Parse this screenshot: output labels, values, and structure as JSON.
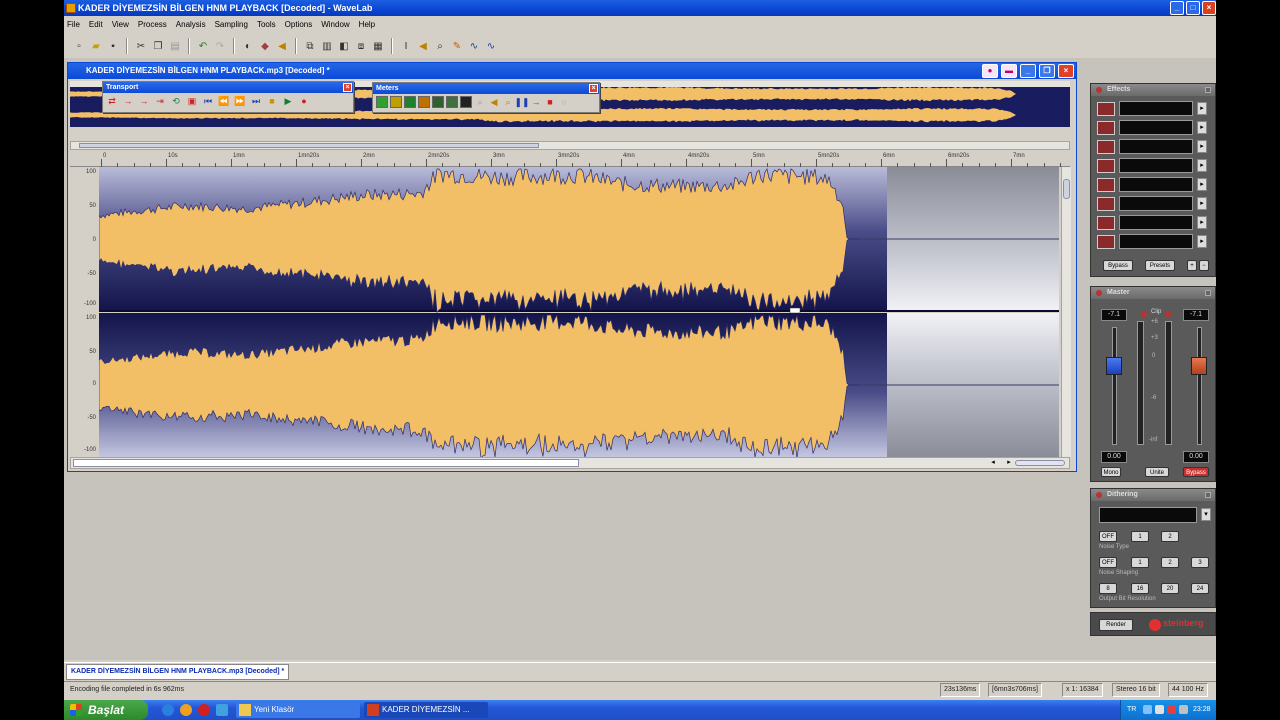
{
  "app": {
    "title": "KADER DİYEMEZSİN BİLGEN HNM PLAYBACK [Decoded] - WaveLab"
  },
  "menu": [
    "File",
    "Edit",
    "View",
    "Process",
    "Analysis",
    "Sampling",
    "Tools",
    "Options",
    "Window",
    "Help"
  ],
  "document": {
    "title": "KADER DİYEMEZSİN BİLGEN HNM PLAYBACK.mp3 [Decoded] *",
    "ruler_labels": [
      "0",
      "10s",
      "1mn",
      "1mn20s",
      "2mn",
      "2mn20s",
      "3mn",
      "3mn20s",
      "4mn",
      "4mn20s",
      "5mn",
      "5mn20s",
      "6mn",
      "6mn20s",
      "7mn"
    ],
    "yaxis_top": [
      "100",
      "50",
      "0",
      "-50",
      "-100"
    ],
    "yaxis_bottom": [
      "100",
      "50",
      "0",
      "-50",
      "-100"
    ]
  },
  "transport": {
    "title": "Transport"
  },
  "meters": {
    "title": "Meters"
  },
  "effects": {
    "title": "Effects",
    "bypass_label": "Bypass",
    "presets_label": "Presets"
  },
  "master": {
    "title": "Master",
    "left_value": "-7.1",
    "right_value": "-7.1",
    "clip_label": "Clip",
    "left_readout": "0.00",
    "right_readout": "0.00",
    "mono_label": "Mono",
    "unite_label": "Unite",
    "bypass_label": "Bypass",
    "scale": [
      "+6",
      "+3",
      "0",
      "-6",
      "-inf"
    ]
  },
  "dithering": {
    "title": "Dithering",
    "noise_type_label": "Noise Type",
    "noise_shaping_label": "Noise Shaping",
    "output_bit_label": "Output Bit Resolution",
    "off_label": "OFF",
    "type_buttons": [
      "1",
      "2"
    ],
    "shaping_buttons": [
      "1",
      "2",
      "3"
    ],
    "bit_buttons": [
      "8",
      "16",
      "20",
      "24"
    ],
    "render_label": "Render",
    "brand": "steinberg"
  },
  "tabs": {
    "doc_tab": "KADER DİYEMEZSİN BİLGEN HNM PLAYBACK.mp3 [Decoded] *"
  },
  "status": {
    "message": "Encoding file completed in 6s 962ms",
    "position": "23s136ms",
    "length": "[6mn3s706ms]",
    "zoom": "x 1: 16384",
    "format": "Stereo 16 bit",
    "rate": "44 100 Hz"
  },
  "taskbar": {
    "start": "Başlat",
    "items": [
      "Yeni Klasör",
      "KADER DİYEMEZSİN ..."
    ],
    "tray_lang": "TR",
    "clock": "23:28"
  },
  "colors": {
    "waveform": "#f2be66",
    "waveform_bg_top": "#1a1c60",
    "waveform_bg_bottom": "#b8bcd8",
    "xp_blue": "#0a46d6"
  },
  "waveform_envelope": {
    "points": [
      0.0,
      0.1,
      0.17,
      0.24,
      0.3,
      0.37,
      0.39,
      0.46,
      0.55,
      0.6,
      0.67,
      0.73,
      0.76,
      0.79,
      0.82,
      0.84,
      0.855,
      0.86
    ],
    "amplitudes": [
      0.35,
      0.5,
      0.45,
      0.55,
      0.65,
      0.68,
      0.98,
      0.92,
      0.96,
      0.82,
      0.78,
      0.8,
      0.98,
      0.93,
      0.94,
      0.88,
      0.5,
      0.0
    ]
  }
}
